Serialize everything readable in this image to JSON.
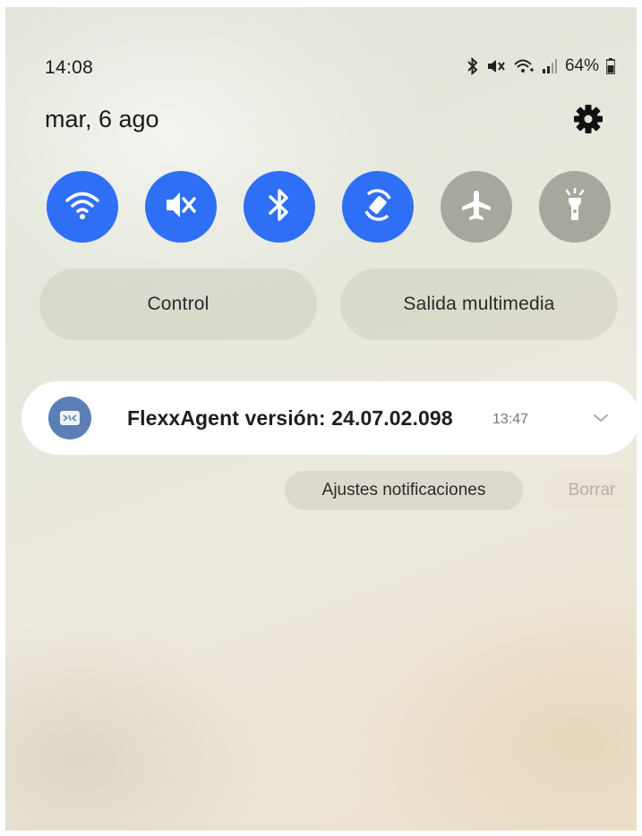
{
  "status_bar": {
    "time": "14:08",
    "battery": "64%",
    "icons": [
      "bluetooth-icon",
      "mute-icon",
      "wifi-plus-icon",
      "signal-icon",
      "battery-icon"
    ]
  },
  "header": {
    "date": "mar, 6 ago",
    "settings_icon": "gear-icon"
  },
  "quick_toggles": [
    {
      "name": "wifi",
      "icon": "wifi-icon",
      "state": "on"
    },
    {
      "name": "sound",
      "icon": "mute-icon",
      "state": "on"
    },
    {
      "name": "bluetooth",
      "icon": "bluetooth-icon",
      "state": "on"
    },
    {
      "name": "auto-rotate",
      "icon": "rotate-icon",
      "state": "on"
    },
    {
      "name": "airplane-mode",
      "icon": "airplane-icon",
      "state": "off"
    },
    {
      "name": "flashlight",
      "icon": "flashlight-icon",
      "state": "off"
    }
  ],
  "panel_buttons": {
    "control_label": "Control",
    "media_output_label": "Salida multimedia"
  },
  "notification": {
    "title": "FlexxAgent versión: 24.07.02.098",
    "time": "13:47",
    "app_icon": "flexxagent-app-icon",
    "expand_icon": "chevron-down-icon"
  },
  "notification_actions": {
    "settings_label": "Ajustes notificaciones",
    "clear_label": "Borrar"
  },
  "colors": {
    "toggle_on": "#2f6ff5",
    "toggle_off": "#a7a79e",
    "app_icon_bg": "#5b7fb4"
  }
}
